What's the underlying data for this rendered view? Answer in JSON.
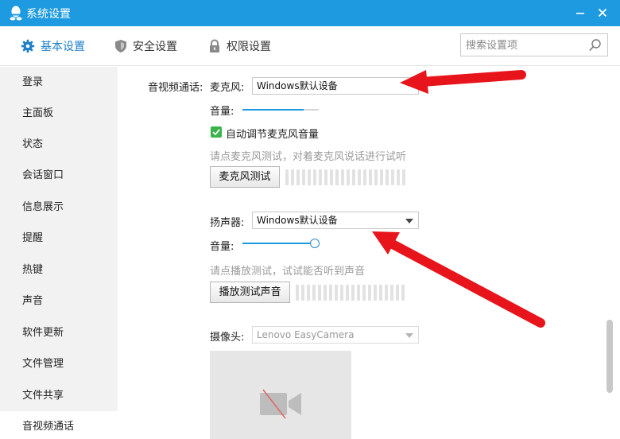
{
  "window": {
    "title": "系统设置",
    "accent_color": "#1e9be0",
    "app_icon": "penguin-icon",
    "minimize_icon": "minimize-icon",
    "close_icon": "close-icon"
  },
  "tabs": [
    {
      "label": "基本设置",
      "icon": "gear-icon",
      "active": true
    },
    {
      "label": "安全设置",
      "icon": "shield-icon",
      "active": false
    },
    {
      "label": "权限设置",
      "icon": "lock-icon",
      "active": false
    }
  ],
  "search": {
    "placeholder": "搜索设置项",
    "icon": "search-icon"
  },
  "sidebar": {
    "items": [
      {
        "label": "登录"
      },
      {
        "label": "主面板"
      },
      {
        "label": "状态"
      },
      {
        "label": "会话窗口"
      },
      {
        "label": "信息展示"
      },
      {
        "label": "提醒"
      },
      {
        "label": "热键"
      },
      {
        "label": "声音"
      },
      {
        "label": "软件更新"
      },
      {
        "label": "文件管理"
      },
      {
        "label": "文件共享"
      },
      {
        "label": "音视频通话",
        "active": true
      }
    ]
  },
  "content": {
    "section_label": "音视频通话:",
    "microphone": {
      "label": "麦克风:",
      "device": "Windows默认设备",
      "volume_label": "音量:",
      "volume_level": 0.8,
      "auto_adjust_label": "自动调节麦克风音量",
      "auto_adjust_checked": true,
      "test_hint": "请点麦克风测试，对着麦克风说话进行试听",
      "test_button": "麦克风测试"
    },
    "speaker": {
      "label": "扬声器:",
      "device": "Windows默认设备",
      "volume_label": "音量:",
      "volume_level": 0.95,
      "test_hint": "请点播放测试，试试能否听到声音",
      "test_button": "播放测试声音"
    },
    "camera": {
      "label": "摄像头:",
      "device": "Lenovo EasyCamera",
      "preview_icon": "camera-off-icon"
    }
  },
  "annotation_color": "#e8141c"
}
